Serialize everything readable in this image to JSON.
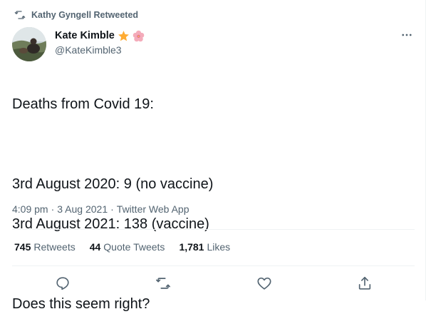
{
  "retweet_context": {
    "icon": "retweet-icon",
    "text": "Kathy Gyngell Retweeted"
  },
  "author": {
    "display_name": "Kate Kimble",
    "handle": "@KateKimble3",
    "badges": [
      "star-emoji",
      "cherry-blossom-emoji"
    ]
  },
  "tweet": {
    "lines": [
      "Deaths from Covid 19:",
      "",
      "3rd August 2020: 9 (no vaccine)",
      "3rd August 2021: 138 (vaccine)",
      "",
      "Does this seem right?"
    ],
    "time": "4:09 pm",
    "date": "3 Aug 2021",
    "source": "Twitter Web App",
    "separator": "·"
  },
  "stats": {
    "retweets_count": "745",
    "retweets_label": "Retweets",
    "quotes_count": "44",
    "quotes_label": "Quote Tweets",
    "likes_count": "1,781",
    "likes_label": "Likes"
  },
  "actions": [
    "reply-icon",
    "retweet-icon",
    "like-icon",
    "share-icon"
  ],
  "colors": {
    "text": "#0f1419",
    "secondary": "#536471",
    "divider": "#eff3f4"
  }
}
